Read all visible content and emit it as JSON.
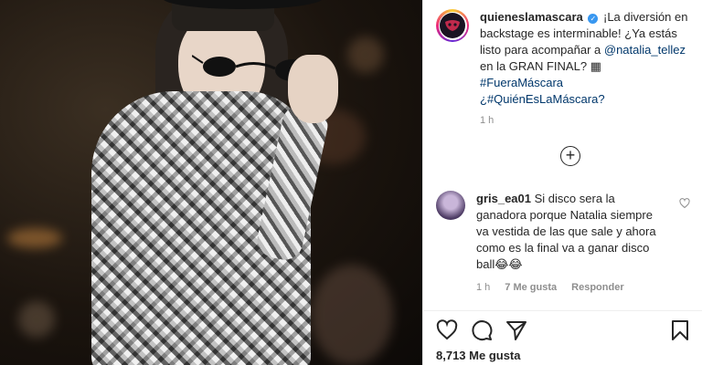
{
  "post": {
    "username": "quieneslamascara",
    "caption_text": "¡La diversión en backstage es interminable! ¿Ya estás listo para acompañar a",
    "mention": "@natalia_tellez",
    "caption_text_2": "en la GRAN FINAL? ▦",
    "hashtag_1": "#FueraMáscara",
    "hashtag_2": "¿#QuiénEsLaMáscara?",
    "time": "1 h"
  },
  "comment": {
    "username": "gris_ea01",
    "text": "Si disco sera la ganadora porque Natalia siempre va vestida de las que sale y ahora como es la final va a ganar disco ball😂😂",
    "time": "1 h",
    "likes": "7 Me gusta",
    "reply": "Responder"
  },
  "actions": {
    "like_count": "8,713 Me gusta"
  },
  "icons": {
    "verified": "verified-badge-icon",
    "load_more": "plus-circle-icon",
    "like": "heart-icon",
    "comment": "comment-icon",
    "share": "paper-plane-icon",
    "save": "bookmark-icon"
  },
  "colors": {
    "link": "#00376b",
    "verified": "#3897f0",
    "muted": "#8e8e8e"
  }
}
